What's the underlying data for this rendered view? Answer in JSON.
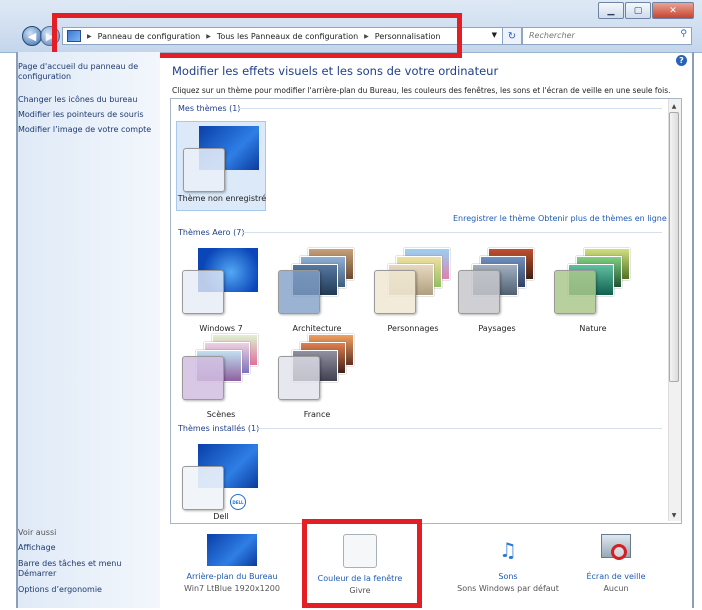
{
  "address": {
    "icon": "control-panel-icon",
    "segments": [
      "Panneau de configuration",
      "Tous les Panneaux de configuration",
      "Personnalisation"
    ]
  },
  "search": {
    "placeholder": "Rechercher"
  },
  "window_buttons": [
    "minimize",
    "maximize",
    "close"
  ],
  "sidebar": {
    "home_link": "Page d'accueil du panneau de configuration",
    "links": [
      "Changer les icônes du bureau",
      "Modifier les pointeurs de souris",
      "Modifier l’image de votre compte"
    ],
    "see_also_heading": "Voir aussi",
    "see_also": [
      "Affichage",
      "Barre des tâches et menu Démarrer",
      "Options d’ergonomie"
    ]
  },
  "main": {
    "title": "Modifier les effets visuels et les sons de votre ordinateur",
    "subtitle": "Cliquez sur un thème pour modifier l'arrière-plan du Bureau, les couleurs des fenêtres, les sons et l'écran de veille en une seule fois.",
    "groups": {
      "my": {
        "heading": "Mes thèmes (1)",
        "themes": [
          "Thème non enregistré"
        ]
      },
      "save_link": "Enregistrer le thème",
      "more_link": "Obtenir plus de thèmes en ligne",
      "aero": {
        "heading": "Thèmes Aero (7)",
        "themes": [
          "Windows 7",
          "Architecture",
          "Personnages",
          "Paysages",
          "Nature",
          "Scènes",
          "France"
        ]
      },
      "installed": {
        "heading": "Thèmes installés (1)",
        "themes": [
          "Dell"
        ]
      }
    }
  },
  "bottom": [
    {
      "label": "Arrière-plan du Bureau",
      "value": "Win7 LtBlue 1920x1200"
    },
    {
      "label": "Couleur de la fenêtre",
      "value": "Givre"
    },
    {
      "label": "Sons",
      "value": "Sons Windows par défaut"
    },
    {
      "label": "Écran de veille",
      "value": "Aucun"
    }
  ],
  "colors": {
    "link": "#1e5bb5",
    "title": "#1e3f8a",
    "highlight": "#e31e24"
  }
}
